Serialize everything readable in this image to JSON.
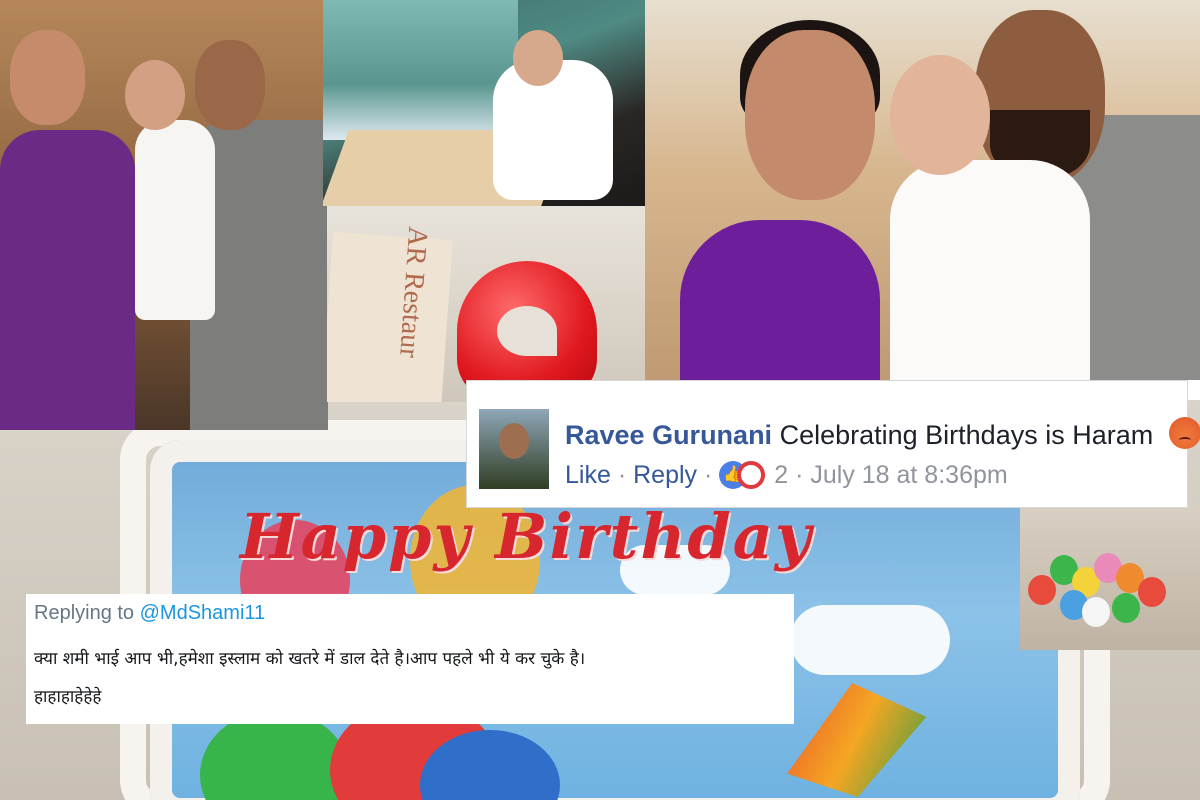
{
  "facebook_comment": {
    "author": "Ravee Gurunani",
    "text": "Celebrating Birthdays is Haram",
    "emoji_icon": "angry-face-icon",
    "like_label": "Like",
    "separator": "·",
    "reply_label": "Reply",
    "reaction_icons": [
      "like-reaction-icon",
      "angry-reaction-icon"
    ],
    "reaction_count": "2",
    "timestamp": "July 18 at 8:36pm"
  },
  "twitter_reply": {
    "replying_prefix": "Replying to",
    "replying_handle": "@MdShami11",
    "line1": "क्या शमी भाई आप भी,हमेशा इस्लाम को खतरे में डाल देते है।आप पहले भी ये कर चुके है।",
    "line2": "हाहाहाहेहेहे"
  },
  "cake": {
    "printed_text": "Happy Birthday"
  },
  "candle_card": {
    "printed_text": "AR Restaur"
  },
  "colors": {
    "facebook_link": "#365899",
    "facebook_meta": "#90949c",
    "twitter_handle": "#1b95e0",
    "cake_text": "#d8262f"
  }
}
